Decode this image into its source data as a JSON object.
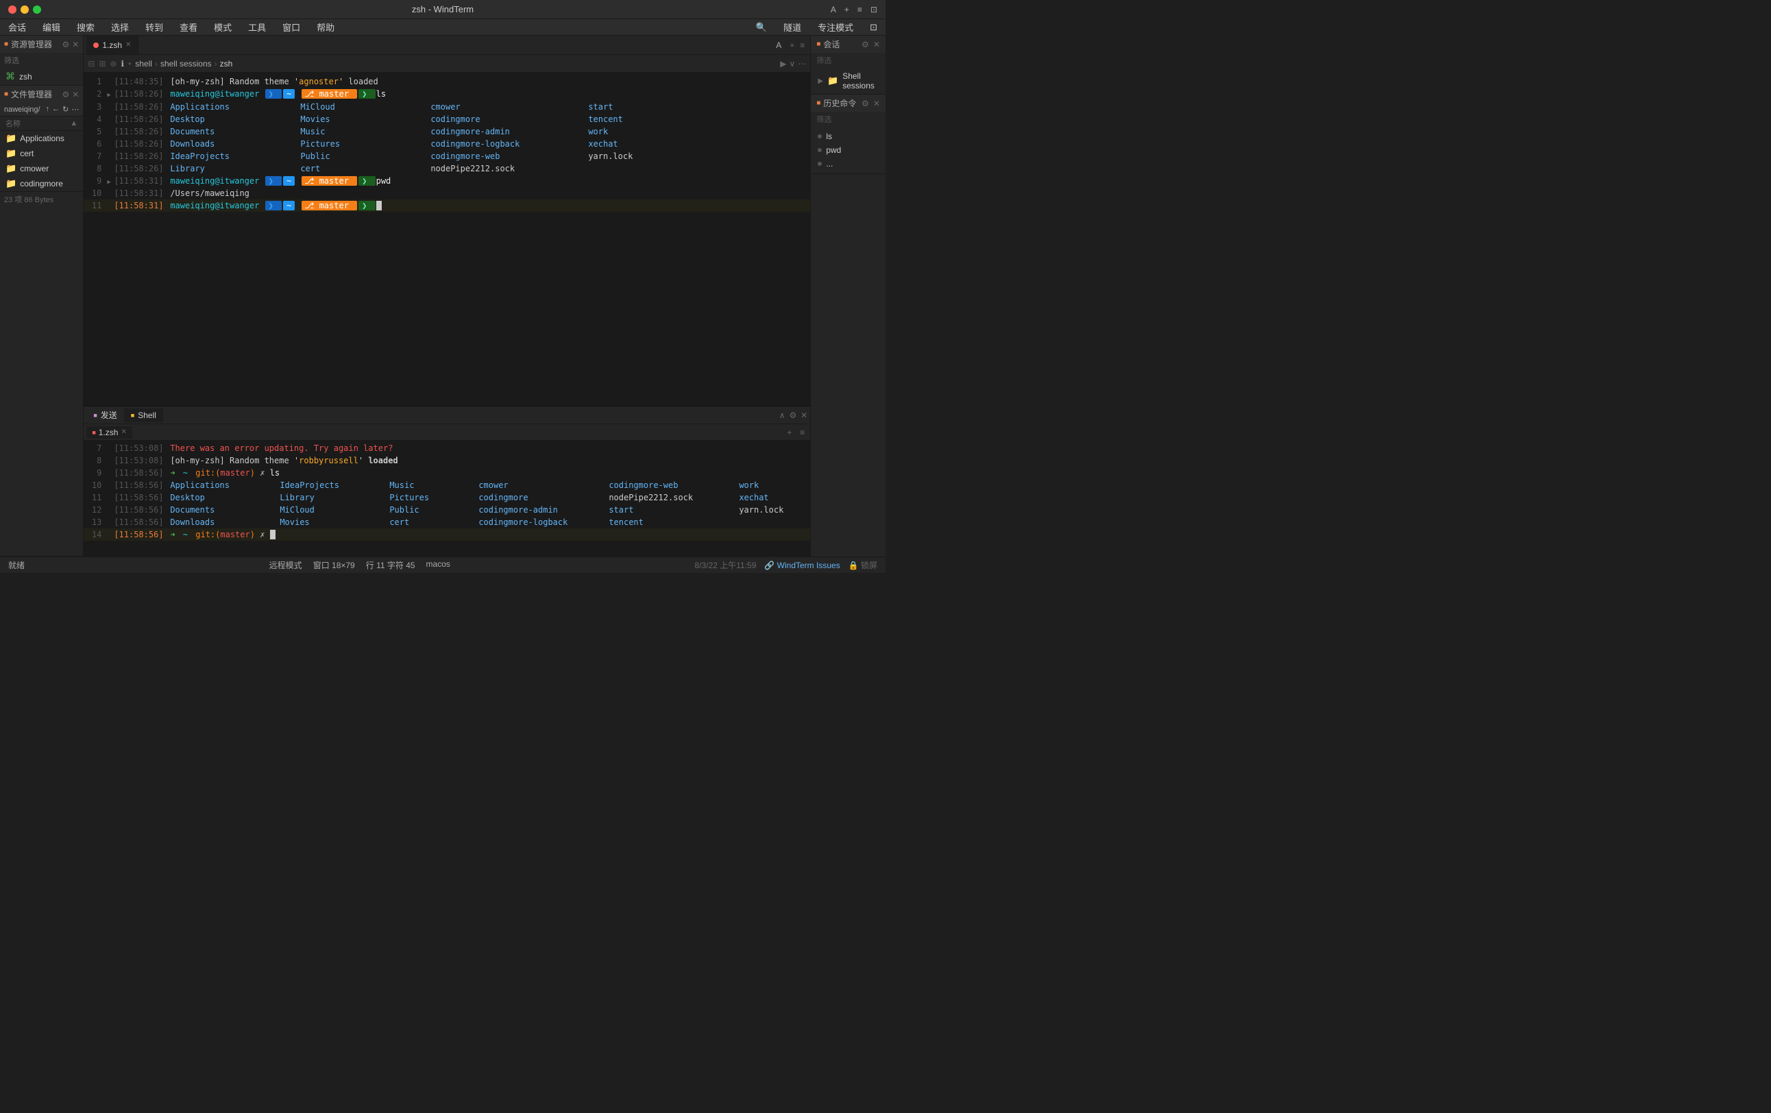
{
  "titlebar": {
    "title": "zsh - WindTerm",
    "actions": [
      "A",
      "+",
      "=",
      "⊡"
    ]
  },
  "menubar": {
    "items": [
      "会话",
      "编辑",
      "搜索",
      "选择",
      "转到",
      "查看",
      "模式",
      "工具",
      "窗口",
      "帮助"
    ]
  },
  "menubar_right": {
    "items": [
      "🔍",
      "隧道",
      "专注模式",
      "⊡"
    ]
  },
  "sidebar_left": {
    "resource_manager": {
      "title": "资源管理器",
      "filter_placeholder": "筛选",
      "items": [
        {
          "label": "zsh",
          "type": "terminal"
        }
      ]
    },
    "file_manager": {
      "title": "文件管理器",
      "path": "naweiqing/",
      "sort_label": "名称",
      "items": [
        {
          "name": "Applications",
          "type": "folder"
        },
        {
          "name": "cert",
          "type": "folder"
        },
        {
          "name": "cmower",
          "type": "folder"
        },
        {
          "name": "codingmore",
          "type": "folder"
        }
      ],
      "status": "23 项 86 Bytes"
    }
  },
  "terminal_main": {
    "tab": {
      "label": "1.zsh",
      "icon": "red-dot"
    },
    "toolbar": {
      "info_icon": "ℹ",
      "breadcrumb": [
        "shell",
        "shell sessions",
        "zsh"
      ],
      "right_icons": [
        "▶",
        "∨",
        "⋯"
      ]
    },
    "lines": [
      {
        "num": 1,
        "time": "[11:48:35]",
        "content_type": "text",
        "text": "[oh-my-zsh] Random theme 'agnoster' loaded",
        "color": "white"
      },
      {
        "num": 2,
        "time": "[11:58:26]",
        "content_type": "prompt",
        "user": "maweiqing@itwanger",
        "tilde": "~",
        "branch": "master",
        "cmd": "ls",
        "has_indicator": true
      },
      {
        "num": 3,
        "time": "[11:58:26]",
        "content_type": "ls",
        "cols": [
          "Applications",
          "MiCloud",
          "cmower",
          "start"
        ]
      },
      {
        "num": 4,
        "time": "[11:58:26]",
        "content_type": "ls",
        "cols": [
          "Desktop",
          "Movies",
          "codingmore",
          "tencent"
        ]
      },
      {
        "num": 5,
        "time": "[11:58:26]",
        "content_type": "ls",
        "cols": [
          "Documents",
          "Music",
          "codingmore-admin",
          "work"
        ]
      },
      {
        "num": 6,
        "time": "[11:58:26]",
        "content_type": "ls",
        "cols": [
          "Downloads",
          "Pictures",
          "codingmore-logback",
          "xechat"
        ]
      },
      {
        "num": 7,
        "time": "[11:58:26]",
        "content_type": "ls",
        "cols": [
          "IdeaProjects",
          "Public",
          "codingmore-web",
          "yarn.lock"
        ]
      },
      {
        "num": 8,
        "time": "[11:58:26]",
        "content_type": "ls",
        "cols": [
          "Library",
          "cert",
          "nodePipe2212.sock",
          ""
        ]
      },
      {
        "num": 9,
        "time": "[11:58:31]",
        "content_type": "prompt",
        "user": "maweiqing@itwanger",
        "tilde": "~",
        "branch": "master",
        "cmd": "pwd",
        "has_indicator": true
      },
      {
        "num": 10,
        "time": "[11:58:31]",
        "content_type": "text",
        "text": "/Users/maweiqing",
        "color": "white"
      },
      {
        "num": 11,
        "time": "[11:58:31]",
        "content_type": "prompt_active",
        "user": "maweiqing@itwanger",
        "tilde": "~",
        "branch": "master",
        "cmd": "",
        "is_active": true
      }
    ]
  },
  "terminal_bottom": {
    "tabs_top": [
      {
        "label": "发送",
        "dot_color": "magenta"
      },
      {
        "label": "Shell",
        "dot_color": "yellow"
      }
    ],
    "active_tab": "Shell",
    "sub_tab": {
      "label": "1.zsh",
      "icon": "red-dot"
    },
    "lines": [
      {
        "num": 7,
        "time": "[11:53:08]",
        "content_type": "text",
        "text": "There was an error updating. Try again later?",
        "color": "red"
      },
      {
        "num": 8,
        "time": "[11:53:08]",
        "content_type": "text",
        "text": "[oh-my-zsh] Random theme 'robbyrussell' loaded",
        "color": "white"
      },
      {
        "num": 9,
        "time": "[11:58:56]",
        "content_type": "prompt_git",
        "cmd": "ls"
      },
      {
        "num": 10,
        "time": "[11:58:56]",
        "content_type": "ls2",
        "cols": [
          "Applications",
          "IdeaProjects",
          "Music",
          "cmower",
          "codingmore-web",
          "work"
        ]
      },
      {
        "num": 11,
        "time": "[11:58:56]",
        "content_type": "ls2",
        "cols": [
          "Desktop",
          "Library",
          "Pictures",
          "codingmore",
          "nodePipe2212.sock",
          "xechat"
        ]
      },
      {
        "num": 12,
        "time": "[11:58:56]",
        "content_type": "ls2",
        "cols": [
          "Documents",
          "MiCloud",
          "Public",
          "codingmore-admin",
          "start",
          "yarn.lock"
        ]
      },
      {
        "num": 13,
        "time": "[11:58:56]",
        "content_type": "ls2",
        "cols": [
          "Downloads",
          "Movies",
          "cert",
          "codingmore-logback",
          "tencent",
          ""
        ]
      },
      {
        "num": 14,
        "time": "[11:58:56]",
        "content_type": "prompt_git_active",
        "cmd": ""
      }
    ]
  },
  "sidebar_right": {
    "conversation": {
      "title": "会话",
      "filter_placeholder": "筛选",
      "items": [
        {
          "label": "Shell sessions",
          "type": "folder",
          "expanded": false
        }
      ]
    },
    "history": {
      "title": "历史命令",
      "filter_placeholder": "筛选",
      "items": [
        "ls",
        "pwd",
        "..."
      ]
    }
  },
  "statusbar": {
    "left": "就绪",
    "center": [
      "远程模式",
      "窗口 18×79",
      "行 11 字符 45",
      "macos"
    ],
    "right_date": "8/3/22 上午11:59",
    "right_issues": "WindTerm Issues",
    "right_lock": "锁屏"
  }
}
